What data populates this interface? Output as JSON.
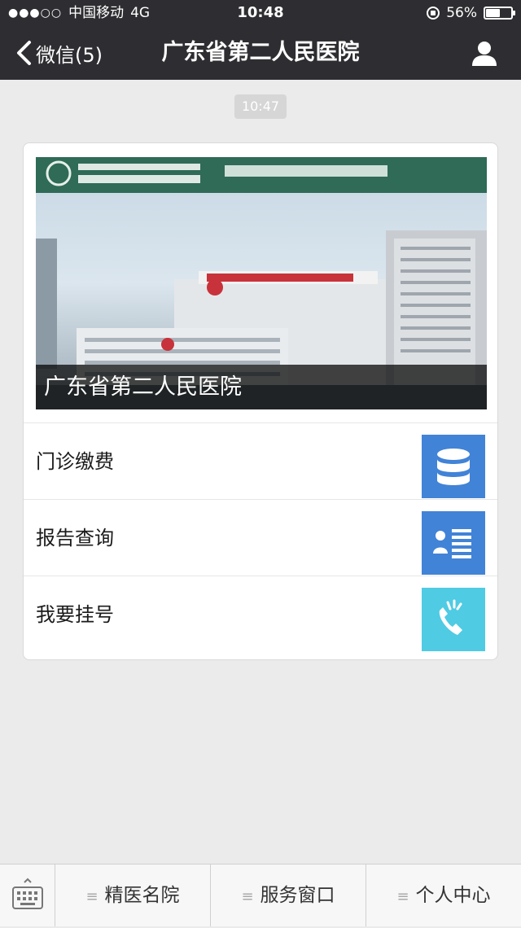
{
  "status_bar": {
    "carrier": "中国移动",
    "network": "4G",
    "time": "10:48",
    "battery": "56%",
    "battery_level": 0.56
  },
  "nav": {
    "back_label": "微信(5)",
    "title": "广东省第二人民医院"
  },
  "chat": {
    "timestamp": "10:47"
  },
  "card": {
    "cover_caption": "广东省第二人民医院",
    "items": [
      {
        "label": "门诊缴费",
        "icon": "database-icon",
        "color": "#4183d7"
      },
      {
        "label": "报告查询",
        "icon": "report-card-icon",
        "color": "#4183d7"
      },
      {
        "label": "我要挂号",
        "icon": "phone-call-icon",
        "color": "#4fcbe3"
      }
    ]
  },
  "bottom_menu": {
    "tabs": [
      {
        "label": "精医名院"
      },
      {
        "label": "服务窗口"
      },
      {
        "label": "个人中心"
      }
    ]
  },
  "colors": {
    "nav_background": "#2e2e32",
    "page_background": "#ebebeb",
    "tile_blue": "#4183d7",
    "tile_cyan": "#4fcbe3"
  }
}
